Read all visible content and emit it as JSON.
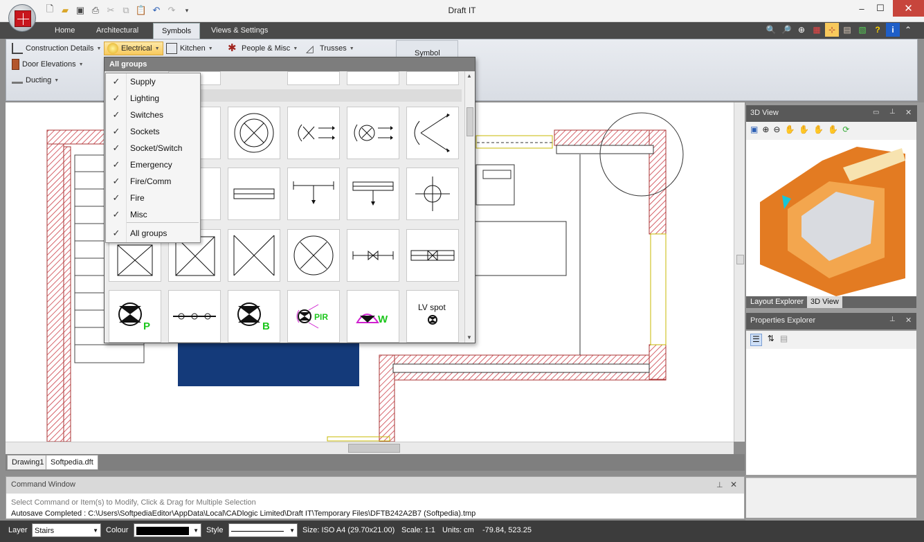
{
  "window": {
    "title": "Draft IT",
    "minimize": "–",
    "maximize": "☐",
    "close": "✕"
  },
  "ribbon_tabs": [
    "Home",
    "Architectural",
    "Symbols",
    "Views & Settings"
  ],
  "ribbon_buttons": {
    "construction_details": "Construction Details",
    "electrical": "Electrical",
    "kitchen": "Kitchen",
    "people_misc": "People & Misc",
    "trusses": "Trusses",
    "door_elevations": "Door Elevations",
    "ducting": "Ducting",
    "symbol": "Symbol"
  },
  "gallery": {
    "header": "All groups",
    "labels": {
      "p": "P",
      "b": "B",
      "pir": "PIR",
      "w": "W",
      "lv_spot": "LV spot"
    }
  },
  "group_menu": {
    "items": [
      "Supply",
      "Lighting",
      "Switches",
      "Sockets",
      "Socket/Switch",
      "Emergency",
      "Fire/Comm",
      "Fire",
      "Misc"
    ],
    "all": "All groups",
    "check": "✓"
  },
  "doc_tabs": [
    "Drawing1",
    "Softpedia.dft"
  ],
  "command_window": {
    "title": "Command Window",
    "hint": "Select Command or Item(s) to Modify, Click & Drag for Multiple Selection",
    "log": "Autosave Completed : C:\\Users\\SoftpediaEditor\\AppData\\Local\\CADlogic Limited\\Draft IT\\Temporary Files\\DFTB242A2B7 (Softpedia).tmp"
  },
  "panels": {
    "view3d": "3D View",
    "layout_explorer": "Layout Explorer",
    "view3d_tab": "3D View",
    "properties": "Properties Explorer"
  },
  "status": {
    "layer_label": "Layer",
    "layer_value": "Stairs",
    "colour_label": "Colour",
    "style_label": "Style",
    "size": "Size: ISO A4 (29.70x21.00)",
    "scale": "Scale: 1:1",
    "units": "Units: cm",
    "coords": "-79.84, 523.25"
  },
  "colors": {
    "accent_selected": "#f8c95c",
    "wall_hatch": "#c8323c",
    "app_red": "#c8161d"
  }
}
